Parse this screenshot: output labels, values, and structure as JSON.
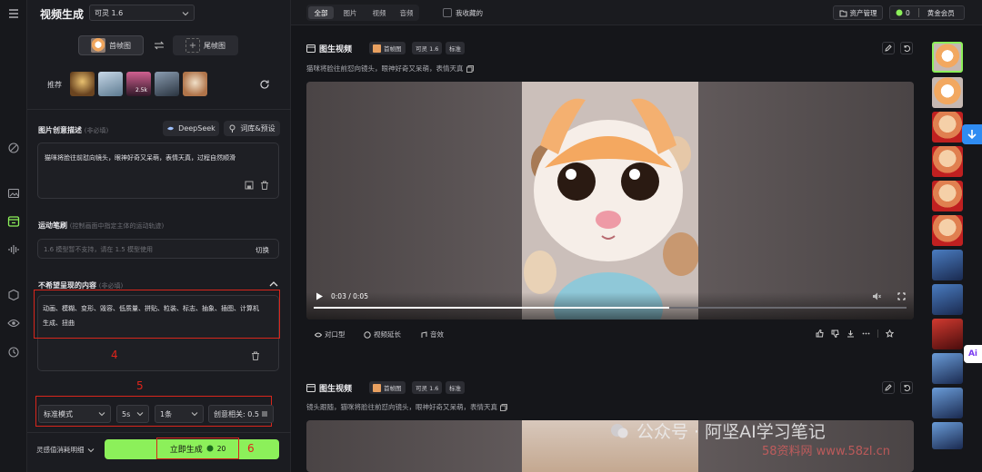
{
  "app": {
    "title": "视频生成",
    "model_select": "可灵 1.6"
  },
  "frames": {
    "first_frame": "首帧图",
    "last_frame": "尾帧图",
    "recommend_label": "推荐",
    "recommend_badge": "2.5k"
  },
  "prompt": {
    "label": "图片创意描述",
    "optional": "(非必填)",
    "deepseek": "DeepSeek",
    "lexicon": "词库&预设",
    "text": "猫咪将脸往前怼向镜头，眼神好奇又呆萌，表情天真，过程自然顺滑"
  },
  "motion": {
    "label": "运动笔刷",
    "hint": "(控制画面中指定主体的运动轨迹)",
    "placeholder": "1.6 模型暂不支持，请在 1.5 模型使用",
    "switch": "切换"
  },
  "negative": {
    "label": "不希望呈现的内容",
    "optional": "(非必填)",
    "text_line1": "动画、模糊、变形、毁容、低质量、拼贴、粒装、标志、抽象、插图、计算机",
    "text_line2": "生成、扭曲"
  },
  "annotations": {
    "n4": "4",
    "n5": "5",
    "n6": "6"
  },
  "settings": {
    "mode": "标准模式",
    "duration": "5s",
    "count": "1条",
    "relevance": "创意相关: 0.5"
  },
  "bottom": {
    "cost_detail": "灵感值消耗明细",
    "generate": "立即生成",
    "cost": "20"
  },
  "topbar": {
    "tabs": [
      "全部",
      "图片",
      "视频",
      "音频"
    ],
    "favorites": "我收藏的",
    "asset_mgmt": "资产管理",
    "points": "0",
    "member": "黄金会员"
  },
  "cards": [
    {
      "title": "图生视频",
      "tag_frame": "首帧图",
      "tag_model": "可灵 1.6",
      "tag_mode": "标准",
      "desc": "猫咪将脸往前怼向镜头，眼神好奇又呆萌，表情天真",
      "time": "0:03 / 0:05",
      "actions": [
        "对口型",
        "视频延长",
        "音效"
      ]
    },
    {
      "title": "图生视频",
      "tag_frame": "首帧图",
      "tag_model": "可灵 1.6",
      "tag_mode": "标准",
      "desc": "镜头跟随，猫咪将脸往前怼向镜头，眼神好奇又呆萌，表情天真"
    }
  ],
  "watermark": {
    "line1": "公众号 · 阿坚AI学习笔记",
    "line2": "58资料网 www.58zl.cn"
  },
  "side_badge": "Ai",
  "colors": {
    "accent_green": "#8cf05a",
    "annotation_red": "#d9261c",
    "scroll_blue": "#2f8cf2"
  }
}
